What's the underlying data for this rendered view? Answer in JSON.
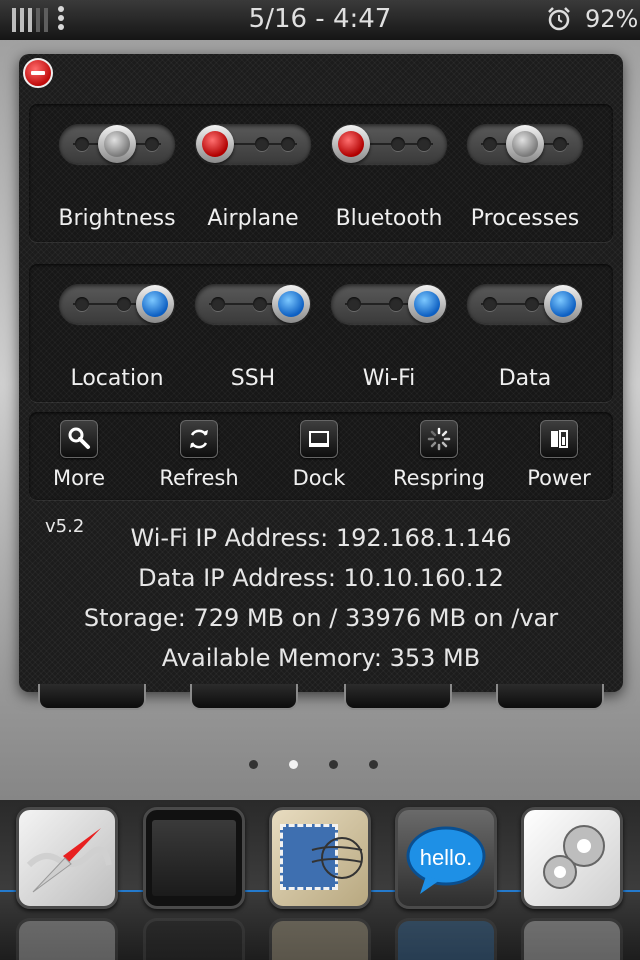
{
  "status_bar": {
    "datetime": "5/16 - 4:47",
    "battery": "92%",
    "signal_icon": "signal-bars-icon",
    "alarm_icon": "alarm-clock-icon"
  },
  "panel": {
    "close_icon": "close-minus-icon",
    "toggles_row1": [
      {
        "label": "Brightness",
        "state": "off",
        "color": "#9a9a9a"
      },
      {
        "label": "Airplane",
        "state": "off",
        "color": "#d01010"
      },
      {
        "label": "Bluetooth",
        "state": "off",
        "color": "#d01010"
      },
      {
        "label": "Processes",
        "state": "mid",
        "color": "#9a9a9a"
      }
    ],
    "toggles_row2": [
      {
        "label": "Location",
        "state": "on",
        "color": "#1a7ee0"
      },
      {
        "label": "SSH",
        "state": "on",
        "color": "#1a7ee0"
      },
      {
        "label": "Wi-Fi",
        "state": "on",
        "color": "#1a7ee0"
      },
      {
        "label": "Data",
        "state": "on",
        "color": "#1a7ee0"
      }
    ],
    "actions": [
      {
        "label": "More",
        "icon": "wrench-magnifier-icon"
      },
      {
        "label": "Refresh",
        "icon": "refresh-icon"
      },
      {
        "label": "Dock",
        "icon": "dock-icon"
      },
      {
        "label": "Respring",
        "icon": "spinner-icon"
      },
      {
        "label": "Power",
        "icon": "battery-power-icon"
      }
    ],
    "version": "v5.2",
    "info": {
      "wifi_ip": "Wi-Fi IP Address: 192.168.1.146",
      "data_ip": "Data IP Address: 10.10.160.12",
      "storage": "Storage: 729 MB on / 33976 MB on /var",
      "memory": "Available Memory: 353 MB"
    }
  },
  "page_indicator": {
    "count": 4,
    "active": 2
  },
  "dock": {
    "apps": [
      {
        "icon": "safari-compass-icon"
      },
      {
        "icon": "phone-screen-icon"
      },
      {
        "icon": "stamp-icon"
      },
      {
        "icon": "hello-speech-bubble-icon",
        "text": "hello."
      },
      {
        "icon": "gears-icon"
      }
    ]
  }
}
